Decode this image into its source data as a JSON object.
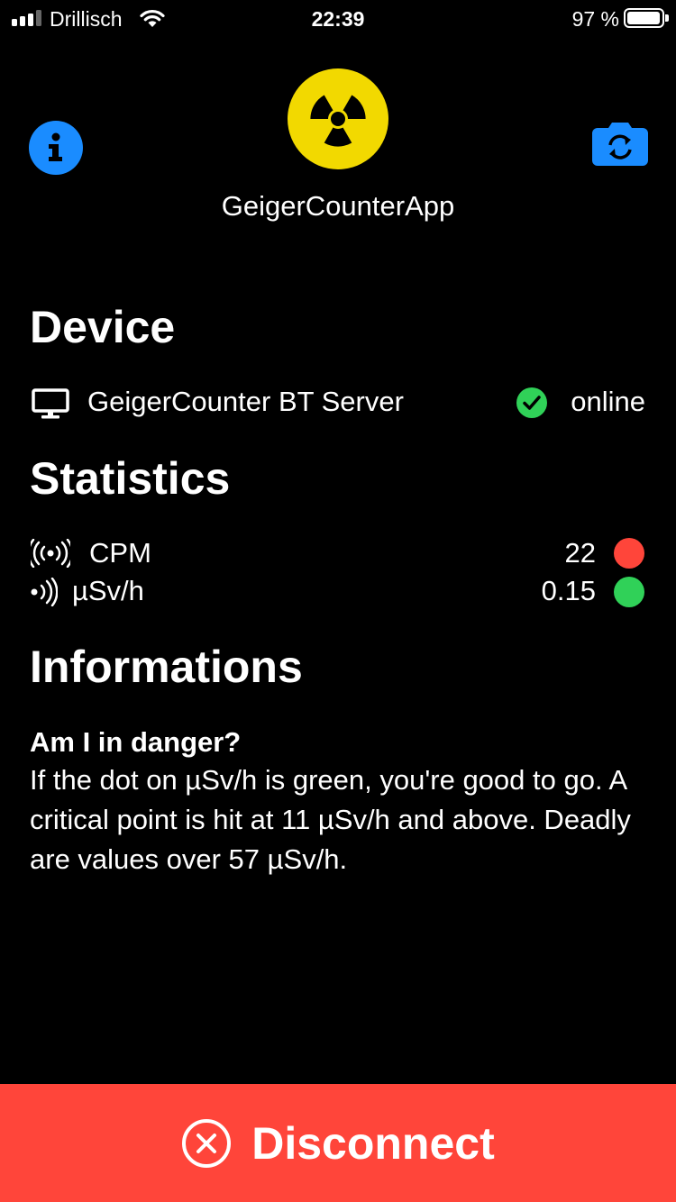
{
  "status_bar": {
    "carrier": "Drillisch",
    "time": "22:39",
    "battery_percent": "97 %",
    "battery_level": 0.97,
    "signal_bars": 3
  },
  "header": {
    "app_title": "GeigerCounterApp",
    "info_icon": "info-icon",
    "logo_icon": "radiation-icon",
    "camera_icon": "camera-switch-icon",
    "accent_color": "#1a8cff",
    "logo_color": "#f2d900"
  },
  "device": {
    "title": "Device",
    "name": "GeigerCounter BT Server",
    "status": "online",
    "status_color": "#30d158",
    "device_icon": "monitor-icon",
    "status_icon": "checkmark-circle-icon"
  },
  "statistics": {
    "title": "Statistics",
    "rows": [
      {
        "label": "CPM",
        "value": "22",
        "indicator_color": "#ff453a",
        "icon": "broadcast-icon"
      },
      {
        "label": "µSv/h",
        "value": "0.15",
        "indicator_color": "#30d158",
        "icon": "signal-waves-icon"
      }
    ]
  },
  "informations": {
    "title": "Informations",
    "heading": "Am I in danger?",
    "body": "If the dot on µSv/h is green, you're good to go. A critical point is hit at 11 µSv/h and above. Deadly are values over 57 µSv/h."
  },
  "disconnect": {
    "label": "Disconnect",
    "icon": "close-circle-icon",
    "color": "#ff453a"
  }
}
